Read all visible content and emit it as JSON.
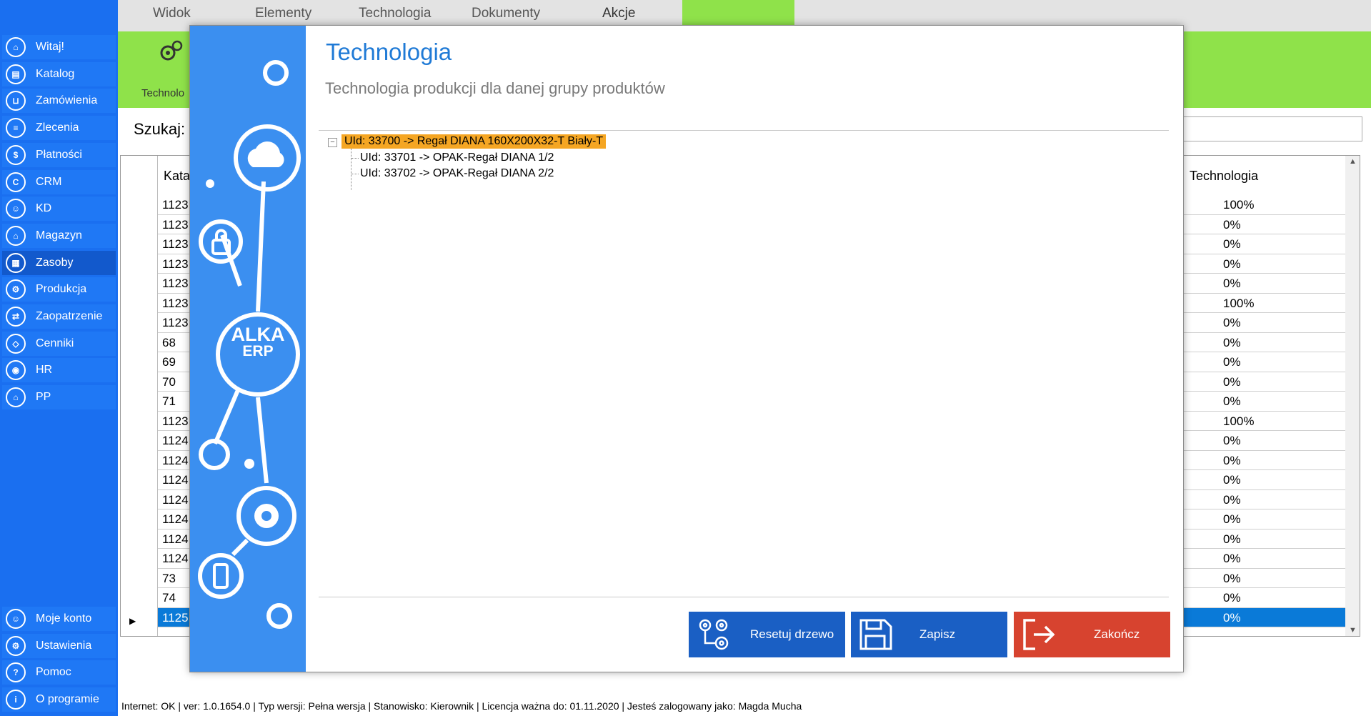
{
  "top_menu": {
    "tabs": [
      {
        "label": "Widok"
      },
      {
        "label": "Elementy"
      },
      {
        "label": "Technologia"
      },
      {
        "label": "Dokumenty"
      },
      {
        "label": "Akcje"
      }
    ],
    "ribbon_button_label": "Technolo"
  },
  "sidebar": {
    "items": [
      {
        "label": "Witaj!",
        "icon": "home-icon"
      },
      {
        "label": "Katalog",
        "icon": "book-icon"
      },
      {
        "label": "Zamówienia",
        "icon": "cart-icon"
      },
      {
        "label": "Zlecenia",
        "icon": "list-icon"
      },
      {
        "label": "Płatności",
        "icon": "dollar-icon"
      },
      {
        "label": "CRM",
        "icon": "crm-icon"
      },
      {
        "label": "KD",
        "icon": "person-icon"
      },
      {
        "label": "Magazyn",
        "icon": "warehouse-icon"
      },
      {
        "label": "Zasoby",
        "icon": "resources-icon"
      },
      {
        "label": "Produkcja",
        "icon": "production-icon"
      },
      {
        "label": "Zaopatrzenie",
        "icon": "supply-icon"
      },
      {
        "label": "Cenniki",
        "icon": "tag-icon"
      },
      {
        "label": "HR",
        "icon": "hr-icon"
      },
      {
        "label": "PP",
        "icon": "factory-icon"
      }
    ],
    "bottom_items": [
      {
        "label": "Moje konto",
        "icon": "user-icon"
      },
      {
        "label": "Ustawienia",
        "icon": "gear-icon"
      },
      {
        "label": "Pomoc",
        "icon": "help-icon"
      },
      {
        "label": "O programie",
        "icon": "info-icon"
      }
    ],
    "active_item": "Zasoby"
  },
  "search": {
    "label": "Szukaj:"
  },
  "grid": {
    "header_kat": "Kata",
    "header_tech": "Technologia",
    "rows": [
      {
        "kat": "1123",
        "tech": "100%"
      },
      {
        "kat": "1123",
        "tech": "0%"
      },
      {
        "kat": "1123",
        "tech": "0%"
      },
      {
        "kat": "1123",
        "tech": "0%"
      },
      {
        "kat": "1123",
        "tech": "0%"
      },
      {
        "kat": "1123",
        "tech": "100%"
      },
      {
        "kat": "1123",
        "tech": "0%"
      },
      {
        "kat": "68",
        "tech": "0%"
      },
      {
        "kat": "69",
        "tech": "0%"
      },
      {
        "kat": "70",
        "tech": "0%"
      },
      {
        "kat": "71",
        "tech": "0%"
      },
      {
        "kat": "1123",
        "tech": "100%"
      },
      {
        "kat": "1124",
        "tech": "0%"
      },
      {
        "kat": "1124",
        "tech": "0%"
      },
      {
        "kat": "1124",
        "tech": "0%"
      },
      {
        "kat": "1124",
        "tech": "0%"
      },
      {
        "kat": "1124",
        "tech": "0%"
      },
      {
        "kat": "1124",
        "tech": "0%"
      },
      {
        "kat": "1124",
        "tech": "0%"
      },
      {
        "kat": "73",
        "tech": "0%"
      },
      {
        "kat": "74",
        "tech": "0%"
      },
      {
        "kat": "1125",
        "tech": "0%",
        "selected": true
      }
    ]
  },
  "status": {
    "text": "Internet: OK  |   ver: 1.0.1654.0   |   Typ wersji: Pełna wersja   |   Stanowisko: Kierownik   |   Licencja ważna do: 01.11.2020   |   Jesteś zalogowany jako: Magda Mucha"
  },
  "modal": {
    "title": "Technologia",
    "subtitle": "Technologia produkcji dla danej grupy produktów",
    "tree": {
      "root": "UId: 33700 -> Regał DIANA 160X200X32-T Biały-T",
      "children": [
        "UId: 33701 -> OPAK-Regał DIANA   1/2",
        "UId: 33702 -> OPAK-Regał DIANA   2/2"
      ]
    },
    "logo_line1": "ALKA",
    "logo_line2": "ERP",
    "buttons": {
      "reset": "Resetuj drzewo",
      "save": "Zapisz",
      "close": "Zakończ"
    }
  },
  "colors": {
    "sidebar_bg": "#1a6ff0",
    "ribbon_green": "#8fe24a",
    "modal_side_blue": "#3b8ff0",
    "title_blue": "#1f7ad6",
    "tree_highlight": "#f5a623",
    "button_blue": "#1a5fc4",
    "button_red": "#d7432f",
    "grid_selected": "#0a7ad8"
  }
}
